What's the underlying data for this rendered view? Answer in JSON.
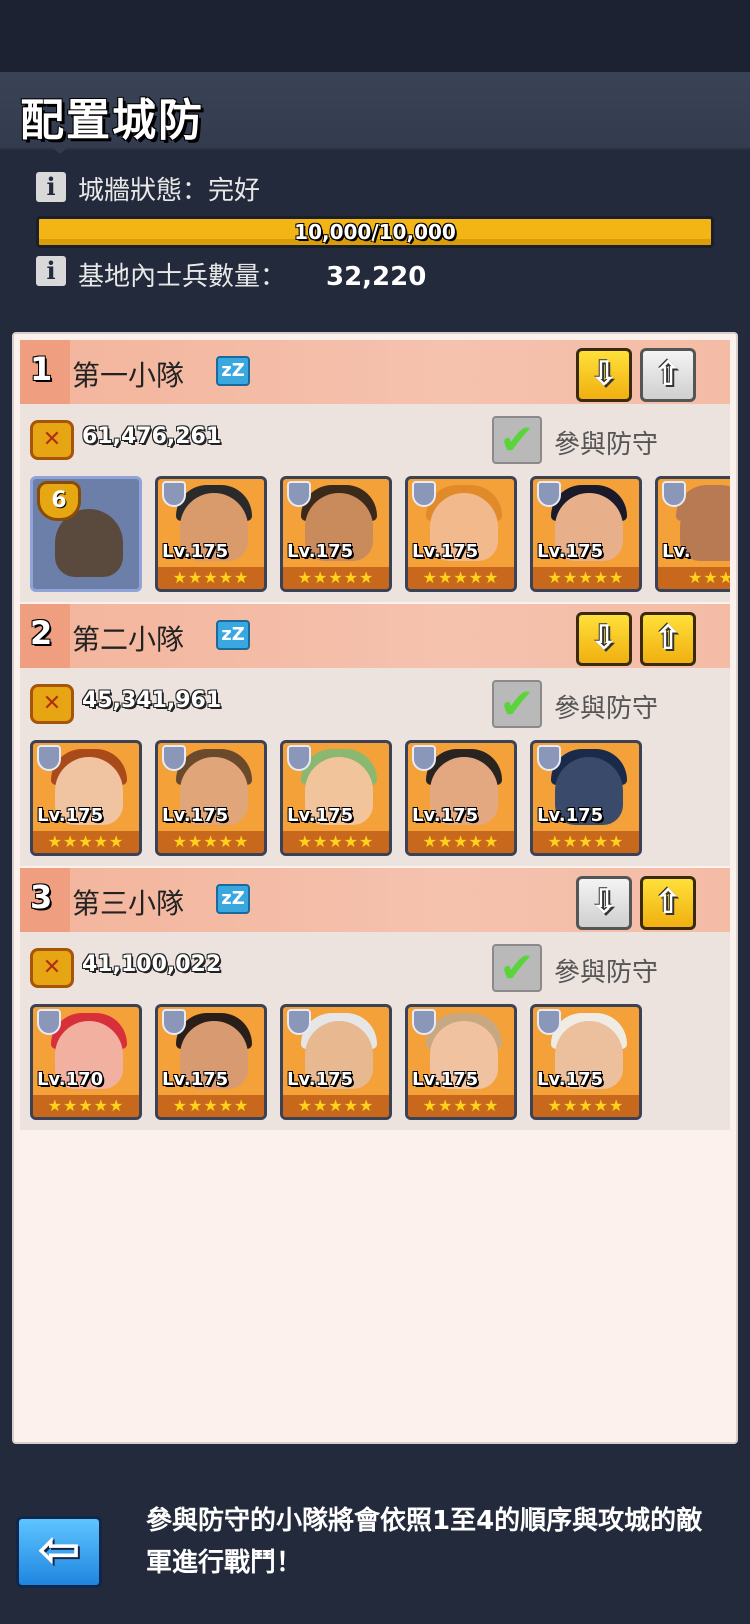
{
  "title": "配置城防",
  "wall": {
    "label": "城牆狀態：完好",
    "progress_text": "10,000/10,000",
    "progress_fraction": 1.0
  },
  "soldiers": {
    "label": "基地內士兵數量：",
    "value": "32,220"
  },
  "info_icon_glyph": "i",
  "squads": [
    {
      "num": "1",
      "name": "第一小隊",
      "power": "61,476,261",
      "defend_label": "參與防守",
      "defend_checked": true,
      "down_active": true,
      "up_active": false,
      "heroes": [
        {
          "leader": true,
          "leader_level": "6",
          "level": "",
          "stars": ""
        },
        {
          "level": "Lv.175",
          "stars": "★★★★★",
          "skin": "#d99a6c",
          "hair": "#2a2a2a"
        },
        {
          "level": "Lv.175",
          "stars": "★★★★★",
          "skin": "#c98a5c",
          "hair": "#3b2a1a"
        },
        {
          "level": "Lv.175",
          "stars": "★★★★★",
          "skin": "#f2b98c",
          "hair": "#e08a2a"
        },
        {
          "level": "Lv.175",
          "stars": "★★★★★",
          "skin": "#e8b08a",
          "hair": "#1a1a2a"
        },
        {
          "level": "Lv.",
          "stars": "★★★",
          "skin": "#b87a52",
          "hair": "#b87a52"
        }
      ]
    },
    {
      "num": "2",
      "name": "第二小隊",
      "power": "45,341,961",
      "defend_label": "參與防守",
      "defend_checked": true,
      "down_active": true,
      "up_active": true,
      "heroes": [
        {
          "level": "Lv.175",
          "stars": "★★★★★",
          "skin": "#f0c4a0",
          "hair": "#a84a1a"
        },
        {
          "level": "Lv.175",
          "stars": "★★★★★",
          "skin": "#e0a67a",
          "hair": "#6a4a2a"
        },
        {
          "level": "Lv.175",
          "stars": "★★★★★",
          "skin": "#f2c49c",
          "hair": "#8ab870"
        },
        {
          "level": "Lv.175",
          "stars": "★★★★★",
          "skin": "#e4a880",
          "hair": "#2a2420"
        },
        {
          "level": "Lv.175",
          "stars": "★★★★★",
          "skin": "#3a4a6a",
          "hair": "#1a2a4a"
        }
      ]
    },
    {
      "num": "3",
      "name": "第三小隊",
      "power": "41,100,022",
      "defend_label": "參與防守",
      "defend_checked": true,
      "down_active": false,
      "up_active": true,
      "heroes": [
        {
          "level": "Lv.170",
          "stars": "★★★★★",
          "skin": "#f2b0a0",
          "hair": "#d8303a"
        },
        {
          "level": "Lv.175",
          "stars": "★★★★★",
          "skin": "#d89a70",
          "hair": "#2a1e18"
        },
        {
          "level": "Lv.175",
          "stars": "★★★★★",
          "skin": "#e8b890",
          "hair": "#e6e6e6"
        },
        {
          "level": "Lv.175",
          "stars": "★★★★★",
          "skin": "#f0c2a0",
          "hair": "#c8a880"
        },
        {
          "level": "Lv.175",
          "stars": "★★★★★",
          "skin": "#ecc09c",
          "hair": "#f0ece4"
        }
      ]
    }
  ],
  "icons": {
    "sleep": "zZ",
    "check": "✔",
    "arrow_down": "⇩",
    "arrow_up": "⇧",
    "back": "⇦",
    "power": "✕"
  },
  "footer": {
    "text": "參與防守的小隊將會依照1至4的順序與攻城的敵軍進行戰鬥！"
  },
  "colors": {
    "accent_yellow": "#f2b515",
    "squad_header": "#f4bca5",
    "panel": "#fdf1ee",
    "back_button": "#1f86e0"
  }
}
